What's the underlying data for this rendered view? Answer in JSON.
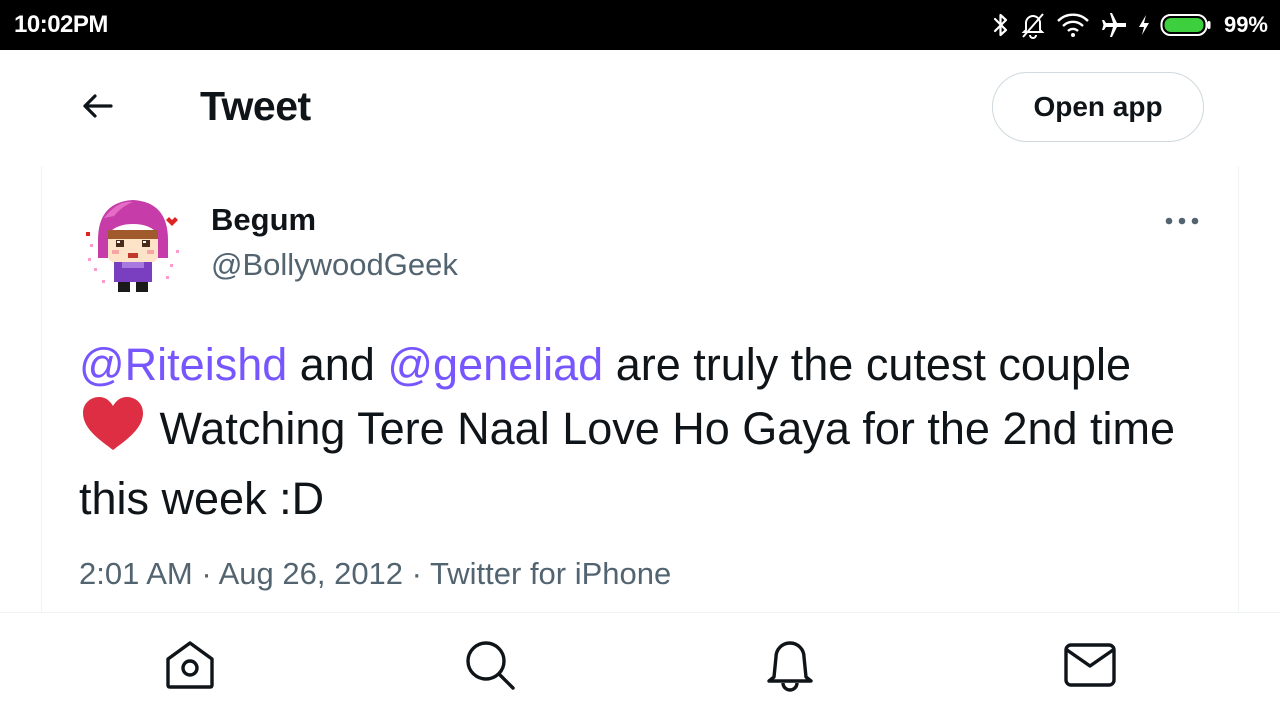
{
  "status_bar": {
    "time": "10:02PM",
    "battery_percent": "99%",
    "icons": [
      "bluetooth-icon",
      "bell-off-icon",
      "wifi-icon",
      "airplane-icon",
      "charging-icon",
      "battery-icon"
    ]
  },
  "header": {
    "back_icon": "arrow-left-icon",
    "title": "Tweet",
    "open_app_label": "Open app"
  },
  "tweet": {
    "author": {
      "display_name": "Begum",
      "handle": "@BollywoodGeek"
    },
    "more_icon": "more-horizontal-icon",
    "text": {
      "mention_1": "@Riteishd",
      "part_1": " and ",
      "mention_2": "@geneliad",
      "part_2": " are truly the cutest couple ",
      "emoji": "heart-emoji",
      "part_3": " Watching Tere Naal Love Ho Gaya for the 2nd time this week :D"
    },
    "meta": {
      "time": "2:01 AM",
      "separator_1": " · ",
      "date": "Aug 26, 2012",
      "separator_2": " · ",
      "source": "Twitter for iPhone"
    }
  },
  "bottom_nav": {
    "items": [
      "home-icon",
      "search-icon",
      "notifications-icon",
      "messages-icon"
    ]
  },
  "colors": {
    "mention": "#7856ff",
    "secondary_text": "#536471",
    "primary_text": "#0f1419",
    "heart": "#dd2e44",
    "divider": "#eff3f4"
  }
}
